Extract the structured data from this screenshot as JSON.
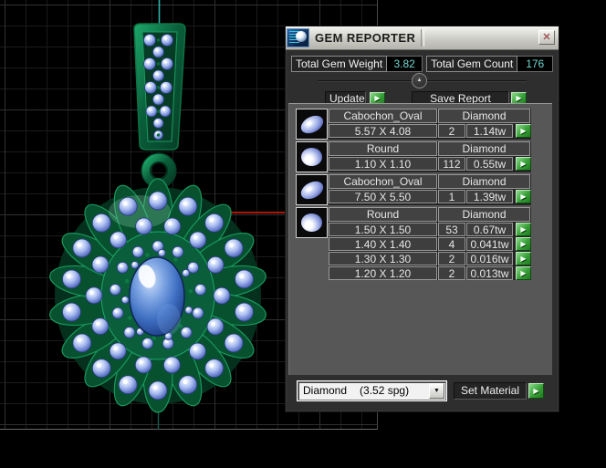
{
  "window": {
    "title": "GEM REPORTER"
  },
  "icons": {
    "close": "✕",
    "run": "▶",
    "collapse": "▲",
    "dropdown": "▼"
  },
  "totals": {
    "weight_label": "Total Gem Weight",
    "weight_value": "3.82",
    "count_label": "Total Gem Count",
    "count_value": "176"
  },
  "actions": {
    "update": "Update",
    "save": "Save Report",
    "set_material": "Set Material"
  },
  "material_dropdown": {
    "selected": "Diamond",
    "spg": "(3.52 spg)"
  },
  "gem_groups": [
    {
      "shape": "Cabochon_Oval",
      "material": "Diamond",
      "rows": [
        {
          "size": "5.57 X 4.08",
          "count": "2",
          "weight": "1.14tw"
        }
      ]
    },
    {
      "shape": "Round",
      "material": "Diamond",
      "rows": [
        {
          "size": "1.10 X 1.10",
          "count": "112",
          "weight": "0.55tw"
        }
      ]
    },
    {
      "shape": "Cabochon_Oval",
      "material": "Diamond",
      "rows": [
        {
          "size": "7.50 X 5.50",
          "count": "1",
          "weight": "1.39tw"
        }
      ]
    },
    {
      "shape": "Round",
      "material": "Diamond",
      "rows": [
        {
          "size": "1.50 X 1.50",
          "count": "53",
          "weight": "0.67tw"
        },
        {
          "size": "1.40 X 1.40",
          "count": "4",
          "weight": "0.041tw"
        },
        {
          "size": "1.30 X 1.30",
          "count": "2",
          "weight": "0.016tw"
        },
        {
          "size": "1.20 X 1.20",
          "count": "2",
          "weight": "0.013tw"
        }
      ]
    }
  ],
  "viewport": {
    "colors": {
      "axis_red": "#a81708",
      "center_line": "#2fb3ab",
      "center_line_faint": "#1b5c55",
      "metal_dark": "#04301d",
      "metal_mid": "#0a5e3a",
      "metal_light": "#1da86a",
      "metal_sheen": "#9fe8c4",
      "gem_light": "#ffffff",
      "gem_mid": "#a9bcf0",
      "gem_dark": "#39499c",
      "cab_light": "#cfe0f8",
      "cab_mid": "#3f6fc2",
      "cab_dark": "#122a62"
    }
  }
}
